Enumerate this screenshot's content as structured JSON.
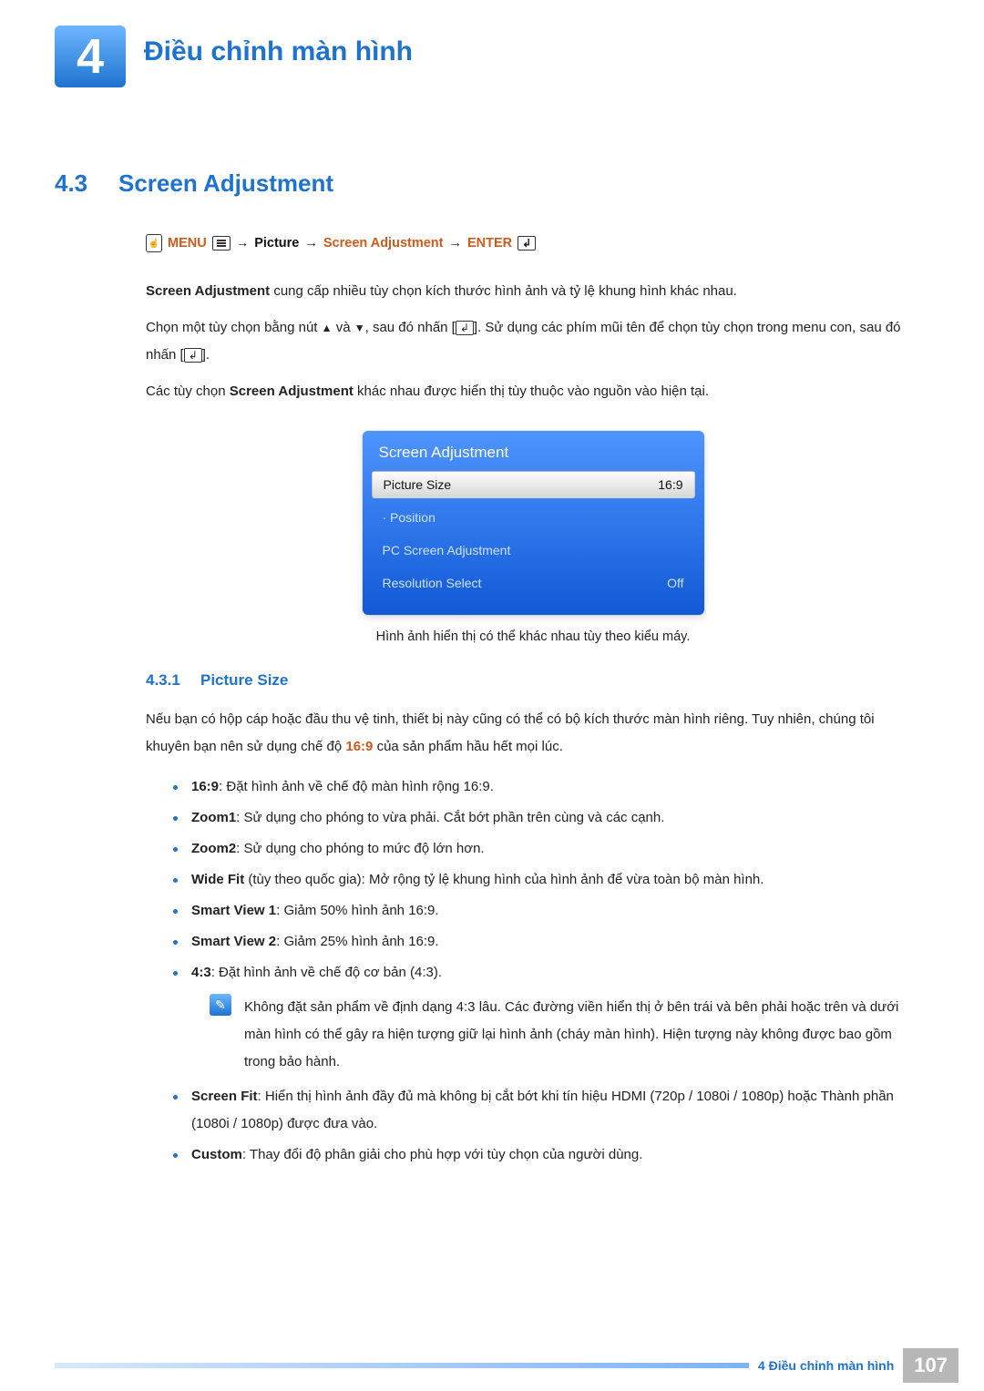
{
  "chapter": {
    "number": "4",
    "title": "Điều chỉnh màn hình"
  },
  "section": {
    "number": "4.3",
    "title": "Screen Adjustment"
  },
  "navpath": {
    "menu": "MENU",
    "picture": "Picture",
    "screen_adj": "Screen Adjustment",
    "enter": "ENTER",
    "arrow": "→"
  },
  "body": {
    "p1_bold": "Screen Adjustment",
    "p1_rest": " cung cấp nhiều tùy chọn kích thước hình ảnh và tỷ lệ khung hình khác nhau.",
    "p2a": "Chọn một tùy chọn bằng nút ",
    "p2b": " và ",
    "p2c": ", sau đó nhấn [",
    "p2d": "]. Sử dụng các phím mũi tên để chọn tùy chọn trong menu con, sau đó nhấn [",
    "p2e": "].",
    "p3a": "Các tùy chọn ",
    "p3_bold": "Screen Adjustment",
    "p3b": " khác nhau được hiển thị tùy thuộc vào nguồn vào hiện tại."
  },
  "osd": {
    "title": "Screen Adjustment",
    "rows": [
      {
        "label": "Picture Size",
        "value": "16:9",
        "selected": true
      },
      {
        "label": "· Position",
        "value": "",
        "selected": false
      },
      {
        "label": "PC Screen Adjustment",
        "value": "",
        "selected": false
      },
      {
        "label": "Resolution Select",
        "value": "Off",
        "selected": false
      }
    ],
    "caption": "Hình ảnh hiển thị có thể khác nhau tùy theo kiểu máy."
  },
  "subsection": {
    "number": "4.3.1",
    "title": "Picture Size"
  },
  "picture_size": {
    "intro_a": "Nếu bạn có hộp cáp hoặc đầu thu vệ tinh, thiết bị này cũng có thể có bộ kích thước màn hình riêng. Tuy nhiên, chúng tôi khuyên bạn nên sử dụng chế độ ",
    "intro_bold": "16:9",
    "intro_b": " của sản phẩm hầu hết mọi lúc.",
    "items": [
      {
        "name": "16:9",
        "desc": ": Đặt hình ảnh về chế độ màn hình rộng 16:9."
      },
      {
        "name": "Zoom1",
        "desc": ": Sử dụng cho phóng to vừa phải. Cắt bớt phần trên cùng và các cạnh."
      },
      {
        "name": "Zoom2",
        "desc": ": Sử dụng cho phóng to mức độ lớn hơn."
      },
      {
        "name": "Wide Fit",
        "desc": " (tùy theo quốc gia): Mở rộng tỷ lệ khung hình của hình ảnh để vừa toàn bộ màn hình."
      },
      {
        "name": "Smart View 1",
        "desc": ": Giảm 50% hình ảnh 16:9."
      },
      {
        "name": "Smart View 2",
        "desc": ": Giảm 25% hình ảnh 16:9."
      },
      {
        "name": "4:3",
        "desc": ": Đặt hình ảnh về chế độ cơ bản (4:3)."
      },
      {
        "name": "Screen Fit",
        "desc": ": Hiển thị hình ảnh đầy đủ mà không bị cắt bớt khi tín hiệu HDMI (720p / 1080i / 1080p) hoặc Thành phần (1080i / 1080p) được đưa vào."
      },
      {
        "name": "Custom",
        "desc": ": Thay đổi độ phân giải cho phù hợp với tùy chọn của người dùng."
      }
    ],
    "note": "Không đặt sản phẩm về định dạng 4:3 lâu. Các đường viền hiển thị ở bên trái và bên phải hoặc trên và dưới màn hình có thể gây ra hiện tượng giữ lại hình ảnh (cháy màn hình). Hiện tượng này không được bao gồm trong bảo hành."
  },
  "footer": {
    "chapter_line": "4 Điều chỉnh màn hình",
    "page": "107"
  }
}
